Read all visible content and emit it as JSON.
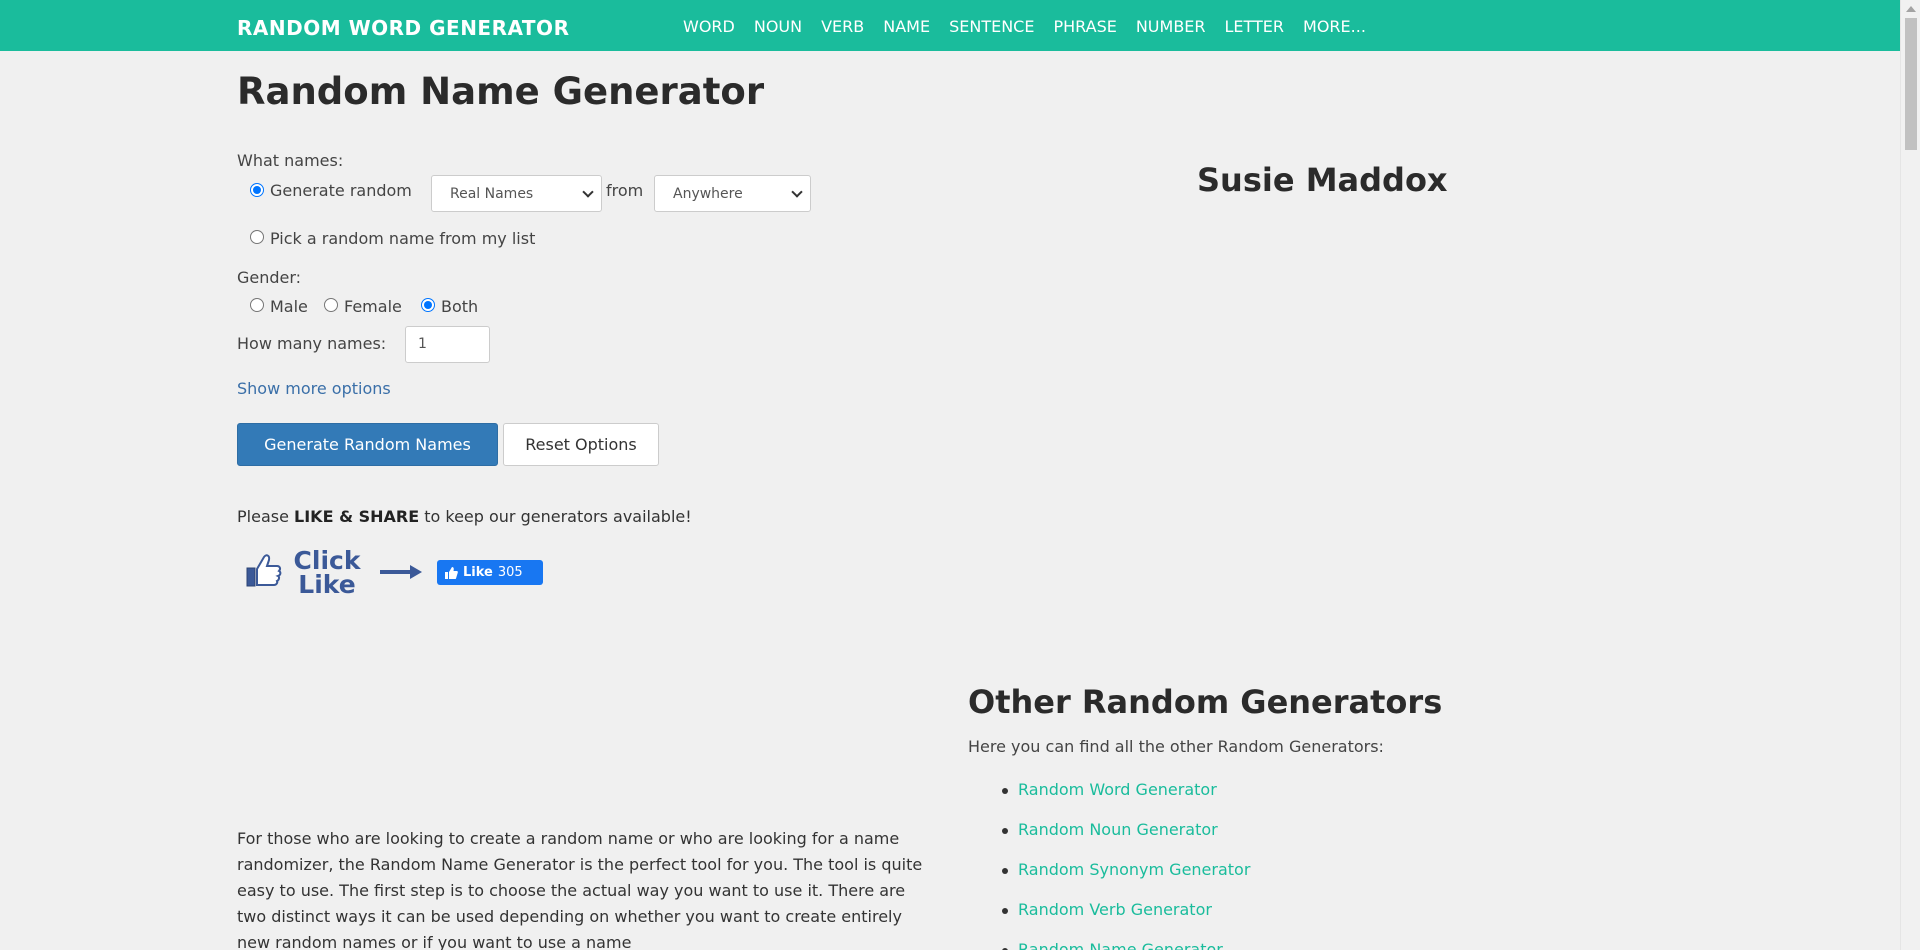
{
  "colors": {
    "brand": "#1abc9c",
    "primary": "#337ab7",
    "facebook": "#1877f2",
    "link": "#3a6fa8"
  },
  "header": {
    "brand": "RANDOM WORD GENERATOR",
    "nav": [
      "WORD",
      "NOUN",
      "VERB",
      "NAME",
      "SENTENCE",
      "PHRASE",
      "NUMBER",
      "LETTER",
      "MORE..."
    ]
  },
  "main": {
    "title": "Random Name Generator",
    "what_names_label": "What names:",
    "generate_random_label": "Generate random",
    "name_type_select": "Real Names",
    "from_label": "from",
    "region_select": "Anywhere",
    "pick_from_list_label": "Pick a random name from my list",
    "gender_label": "Gender:",
    "gender_options": [
      "Male",
      "Female",
      "Both"
    ],
    "gender_selected": "Both",
    "how_many_label": "How many names:",
    "how_many_value": "1",
    "show_more": "Show more options",
    "generate_button": "Generate Random Names",
    "reset_button": "Reset Options",
    "share_prefix": "Please ",
    "share_bold": "LIKE & SHARE",
    "share_suffix": " to keep our generators available!",
    "click_like_line1": "Click",
    "click_like_line2": "Like",
    "fb_like_label": "Like",
    "fb_like_count": "305"
  },
  "result": {
    "name": "Susie Maddox"
  },
  "other": {
    "title": "Other Random Generators",
    "intro": "Here you can find all the other Random Generators:",
    "links": [
      "Random Word Generator",
      "Random Noun Generator",
      "Random Synonym Generator",
      "Random Verb Generator",
      "Random Name Generator"
    ]
  },
  "description": "For those who are looking to create a random name or who are looking for a name randomizer, the Random Name Generator is the perfect tool for you. The tool is quite easy to use. The first step is to choose the actual way you want to use it. There are two distinct ways it can be used depending on whether you want to create entirely new random names or if you want to use a name"
}
